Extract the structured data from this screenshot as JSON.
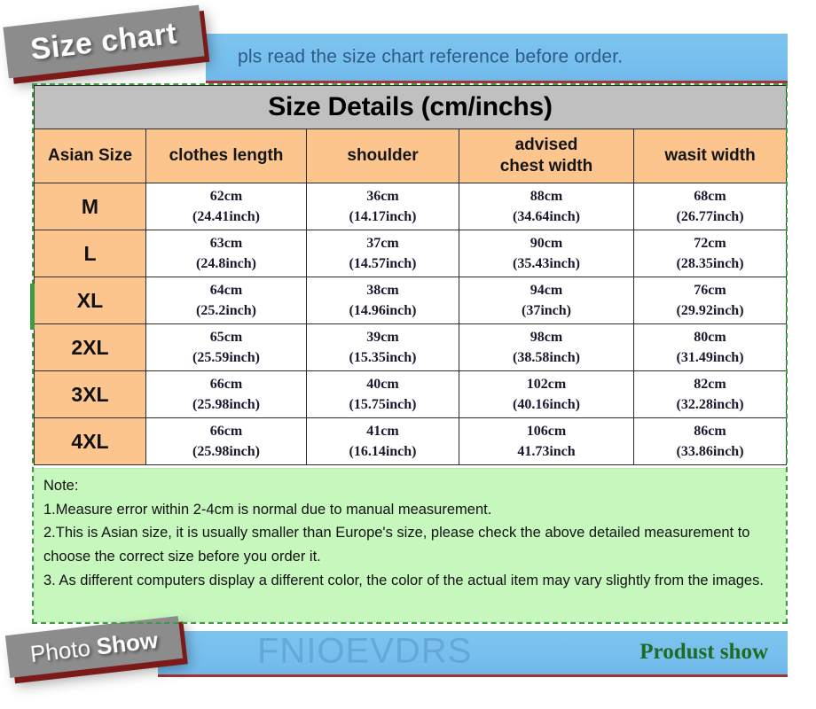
{
  "banners": {
    "top_notice": "pls read the size chart reference before order.",
    "size_chart_tag": "Size chart",
    "photo_show_tag_light": "Photo",
    "photo_show_tag_bold": "Show",
    "watermark": "FNIOEVDRS",
    "product_show": "Produst show"
  },
  "colors": {
    "banner_blue": "#77bfee",
    "banner_text": "#2d5a86",
    "banner_underline": "#a83232",
    "ribbon_grey": "#8c8c8c",
    "ribbon_shadow": "#7c1a1a",
    "title_grey": "#c0c0c0",
    "header_orange": "#fbc58d",
    "note_green": "#c6f7bd",
    "selection_green": "#3f9b3f",
    "product_show_green": "#1f6b24"
  },
  "table": {
    "title": "Size Details (cm/inchs)",
    "headers": [
      {
        "line1": "Asian Size",
        "line2": ""
      },
      {
        "line1": "clothes length",
        "line2": ""
      },
      {
        "line1": "shoulder",
        "line2": ""
      },
      {
        "line1": "advised",
        "line2": "chest width"
      },
      {
        "line1": "wasit width",
        "line2": ""
      }
    ],
    "rows": [
      {
        "size": "M",
        "clothes_length_cm": "62cm",
        "clothes_length_in": "(24.41inch)",
        "shoulder_cm": "36cm",
        "shoulder_in": "(14.17inch)",
        "chest_cm": "88cm",
        "chest_in": "(34.64inch)",
        "waist_cm": "68cm",
        "waist_in": "(26.77inch)"
      },
      {
        "size": "L",
        "clothes_length_cm": "63cm",
        "clothes_length_in": "(24.8inch)",
        "shoulder_cm": "37cm",
        "shoulder_in": "(14.57inch)",
        "chest_cm": "90cm",
        "chest_in": "(35.43inch)",
        "waist_cm": "72cm",
        "waist_in": "(28.35inch)"
      },
      {
        "size": "XL",
        "clothes_length_cm": "64cm",
        "clothes_length_in": "(25.2inch)",
        "shoulder_cm": "38cm",
        "shoulder_in": "(14.96inch)",
        "chest_cm": "94cm",
        "chest_in": "(37inch)",
        "waist_cm": "76cm",
        "waist_in": "(29.92inch)"
      },
      {
        "size": "2XL",
        "clothes_length_cm": "65cm",
        "clothes_length_in": "(25.59inch)",
        "shoulder_cm": "39cm",
        "shoulder_in": "(15.35inch)",
        "chest_cm": "98cm",
        "chest_in": "(38.58inch)",
        "waist_cm": "80cm",
        "waist_in": "(31.49inch)"
      },
      {
        "size": "3XL",
        "clothes_length_cm": "66cm",
        "clothes_length_in": "(25.98inch)",
        "shoulder_cm": "40cm",
        "shoulder_in": "(15.75inch)",
        "chest_cm": "102cm",
        "chest_in": "(40.16inch)",
        "waist_cm": "82cm",
        "waist_in": "(32.28inch)"
      },
      {
        "size": "4XL",
        "clothes_length_cm": "66cm",
        "clothes_length_in": "(25.98inch)",
        "shoulder_cm": "41cm",
        "shoulder_in": "(16.14inch)",
        "chest_cm": "106cm",
        "chest_in": "41.73inch",
        "waist_cm": "86cm",
        "waist_in": "(33.86inch)"
      }
    ]
  },
  "note": {
    "heading": "Note:",
    "line1": "1.Measure error within 2-4cm is normal due to manual measurement.",
    "line2": "2.This is Asian size, it is usually smaller than Europe's size, please check the above detailed measurement to choose the correct size before you order it.",
    "line3": "3. As different computers display a different color, the color of the actual item may vary slightly from the images."
  }
}
